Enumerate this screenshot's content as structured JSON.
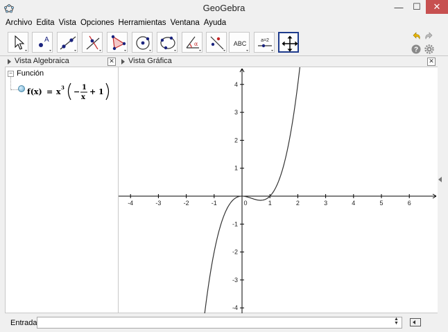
{
  "app": {
    "title": "GeoGebra"
  },
  "menu": [
    "Archivo",
    "Edita",
    "Vista",
    "Opciones",
    "Herramientas",
    "Ventana",
    "Ayuda"
  ],
  "toolbar": {
    "tools": [
      "move",
      "point",
      "line",
      "perpendicular",
      "polygon",
      "circle",
      "conic",
      "angle",
      "reflect",
      "text",
      "slider",
      "move-graphics-view"
    ],
    "selected": "move-graphics-view",
    "text_tool_label": "ABC",
    "slider_tool_label": "a=2"
  },
  "algebra": {
    "title": "Vista Algebraica",
    "category": "Función",
    "function": {
      "name": "f(x)",
      "eq": "=",
      "base": "x",
      "exp": "3",
      "minus": "−",
      "num": "1",
      "den": "x",
      "plus": "+ 1"
    }
  },
  "graphics": {
    "title": "Vista Gráfica",
    "x_ticks": [
      "-4",
      "-3",
      "-2",
      "-1",
      "0",
      "1",
      "2",
      "3",
      "4",
      "5",
      "6"
    ],
    "y_ticks": [
      "4",
      "3",
      "2",
      "1",
      "-1",
      "-2",
      "-3",
      "-4"
    ]
  },
  "input": {
    "label": "Entrada:",
    "value": ""
  },
  "colors": {
    "selected_tool": "#1e3b8c",
    "close_button": "#c75050",
    "curve": "#333333"
  }
}
